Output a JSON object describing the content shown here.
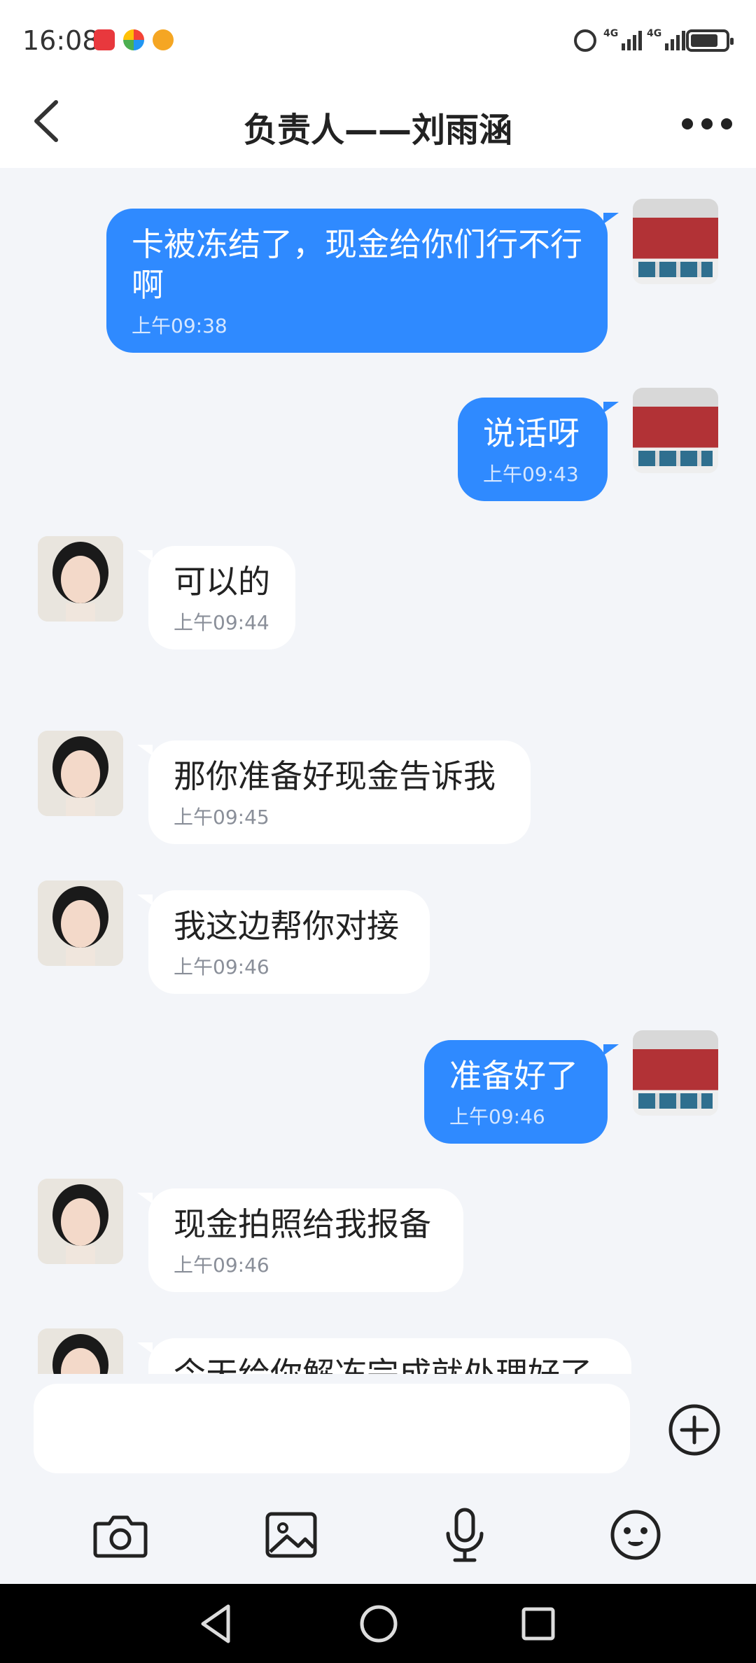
{
  "status_bar": {
    "time": "16:08",
    "network_1": "4G",
    "network_2": "4G"
  },
  "header": {
    "title": "负责人——刘雨涵",
    "back_icon": "chevron-left-icon",
    "more_icon": "more-dots-icon"
  },
  "messages": [
    {
      "side": "out",
      "text": "卡被冻结了，现金给你们行不行啊",
      "time": "上午09:38"
    },
    {
      "side": "out",
      "text": "说话呀",
      "time": "上午09:43"
    },
    {
      "side": "in",
      "text": "可以的",
      "time": "上午09:44"
    },
    {
      "side": "in",
      "text": "那你准备好现金告诉我",
      "time": "上午09:45"
    },
    {
      "side": "in",
      "text": "我这边帮你对接",
      "time": "上午09:46"
    },
    {
      "side": "out",
      "text": "准备好了",
      "time": "上午09:46"
    },
    {
      "side": "in",
      "text": "现金拍照给我报备",
      "time": "上午09:46"
    },
    {
      "side": "in",
      "text": "今天给你解冻完成就处理好了",
      "time": ""
    }
  ],
  "input": {
    "value": "",
    "placeholder": ""
  },
  "toolbar": {
    "icons": [
      "camera-icon",
      "image-icon",
      "microphone-icon",
      "emoji-icon",
      "plus-icon"
    ]
  },
  "colors": {
    "outgoing_bubble": "#2f8aff",
    "incoming_bubble": "#ffffff",
    "background": "#f3f5f9"
  }
}
